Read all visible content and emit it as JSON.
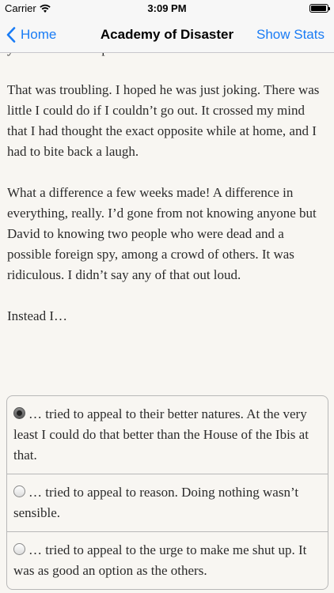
{
  "status_bar": {
    "carrier": "Carrier",
    "time": "3:09 PM",
    "battery_level": 0.95
  },
  "nav": {
    "back_label": "Home",
    "title": "Academy of Disaster",
    "stats_label": "Show Stats"
  },
  "story": {
    "paragraphs": [
      "you’re on an escape risk list.”",
      "That was troubling. I hoped he was just joking. There was little I could do if I couldn’t go out. It crossed my mind that I had thought the exact opposite while at home, and I had to bite back a laugh.",
      "What a difference a few weeks made! A difference in everything, really. I’d gone from not knowing anyone but David to knowing two people who were dead and a possible foreign spy, among a crowd of others. It was ridiculous. I didn’t say any of that out loud.",
      "Instead I…"
    ]
  },
  "choices": [
    {
      "text": "… tried to appeal to their better natures. At the very least I could do that better than the House of the Ibis at that.",
      "selected": true
    },
    {
      "text": "… tried to appeal to reason. Doing nothing wasn’t sensible.",
      "selected": false
    },
    {
      "text": "… tried to appeal to the urge to make me shut up. It was as good an option as the others.",
      "selected": false
    }
  ],
  "colors": {
    "accent": "#1a7cf5",
    "background": "#f8f6f2",
    "text": "#2b2b2b"
  }
}
